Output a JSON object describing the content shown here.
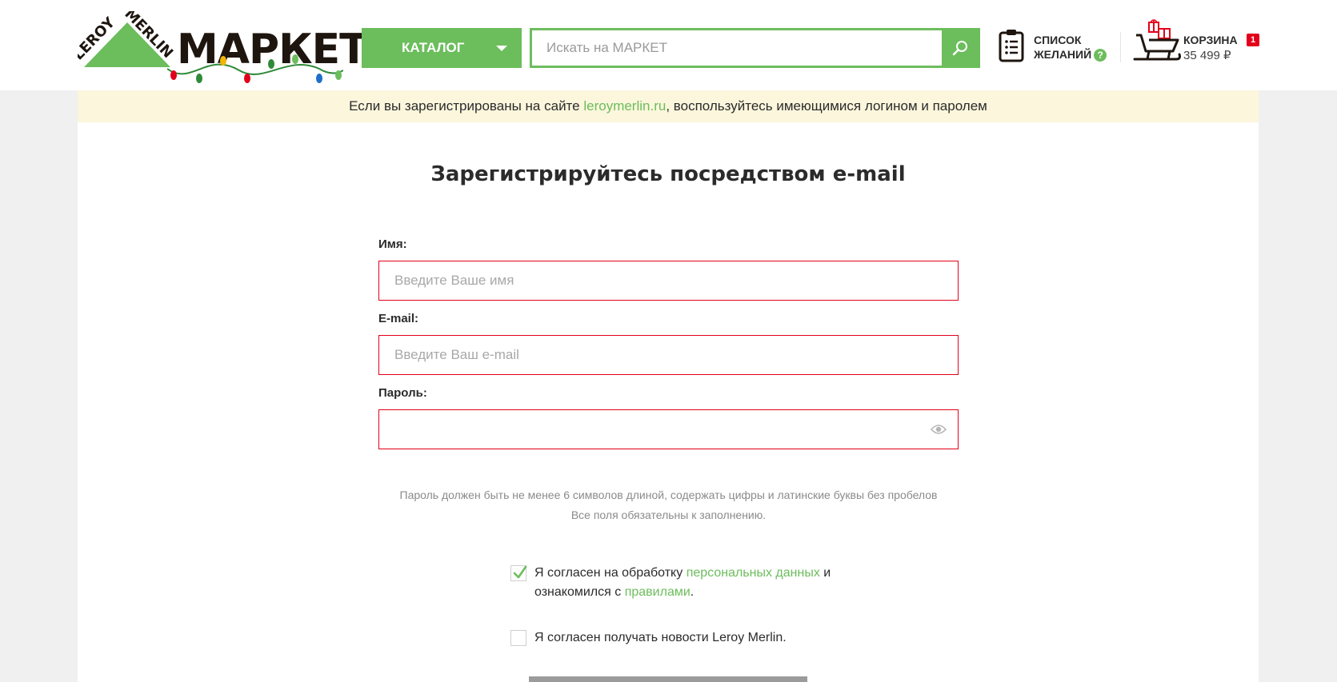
{
  "header": {
    "logo": {
      "brand_text": "LEROY MERLIN",
      "market_text": "МАРКЕТ"
    },
    "catalog_label": "КАТАЛОГ",
    "search_placeholder": "Искать на МАРКЕТ",
    "wishlist": {
      "line1": "СПИСОК",
      "line2": "ЖЕЛАНИЙ",
      "help": "?"
    },
    "cart": {
      "label": "КОРЗИНА",
      "sum": "35 499 ₽",
      "count": "1"
    }
  },
  "notice": {
    "before": "Если вы зарегистрированы на сайте ",
    "link": "leroymerlin.ru",
    "after": ", воспользуйтесь имеющимися логином и паролем"
  },
  "form": {
    "title": "Зарегистрируйтесь посредством e-mail",
    "name_label": "Имя:",
    "name_placeholder": "Введите Ваше имя",
    "email_label": "E-mail:",
    "email_placeholder": "Введите Ваш e-mail",
    "password_label": "Пароль:",
    "password_placeholder": "",
    "hint_line1": "Пароль должен быть не менее 6 символов длиной, содержать цифры и латинские буквы без пробелов",
    "hint_line2": "Все поля обязательны к заполнению.",
    "consent": {
      "checked": true,
      "t1": "Я согласен на обработку ",
      "link1": "персональных данных",
      "t2": " и",
      "t3": "ознакомился с ",
      "link2": "правилами",
      "t4": "."
    },
    "news": {
      "checked": false,
      "text": "Я согласен получать новости Leroy Merlin."
    }
  },
  "colors": {
    "accent": "#6cbd5c",
    "error": "#e2001a",
    "notice_bg": "#fbf6dc"
  },
  "icons": [
    "logo-triangle",
    "search-icon",
    "wishlist-icon",
    "help-icon",
    "cart-sleigh-icon",
    "eye-icon",
    "checkmark-icon"
  ]
}
